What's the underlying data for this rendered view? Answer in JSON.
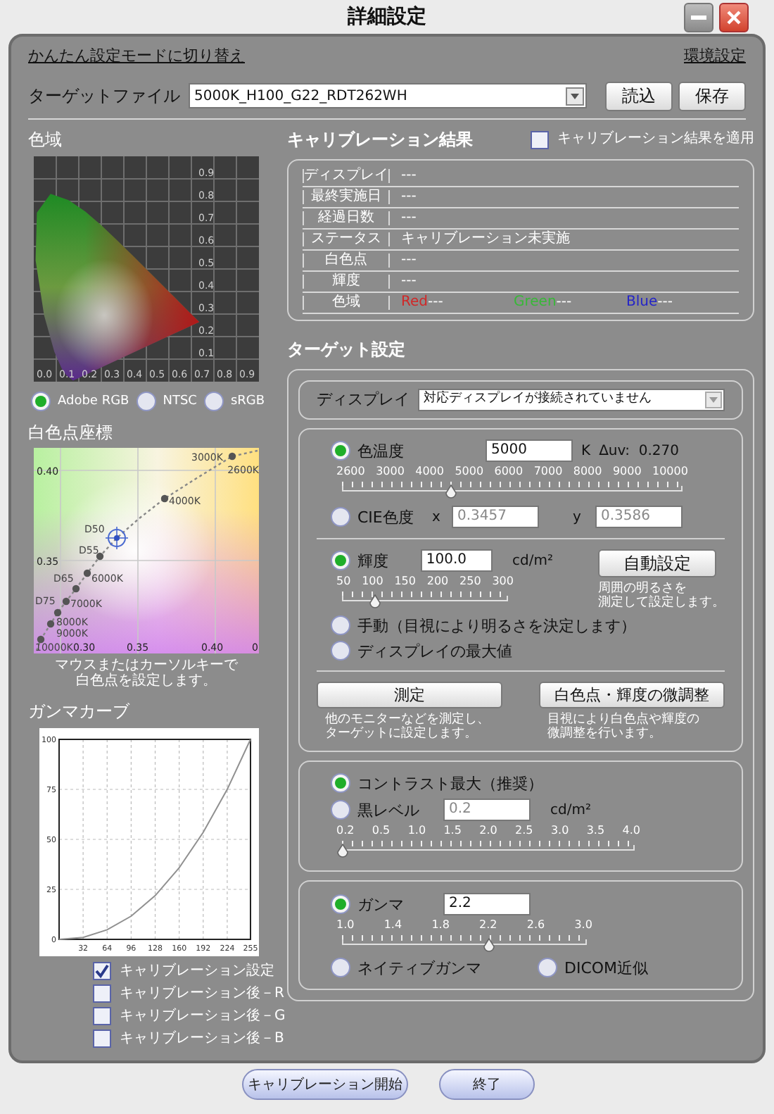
{
  "window": {
    "title": "詳細設定"
  },
  "links": [
    "かんたん設定モードに切り替え",
    "環境設定"
  ],
  "target_file": {
    "label": "ターゲットファイル",
    "value": "5000K_H100_G22_RDT262WH",
    "buttons": [
      "読込",
      "保存"
    ]
  },
  "gamut": {
    "title": "色域",
    "x_ticks": [
      "0.0",
      "0.1",
      "0.2",
      "0.3",
      "0.4",
      "0.5",
      "0.6",
      "0.7",
      "0.8",
      "0.9"
    ],
    "y_ticks": [
      "0.9",
      "0.8",
      "0.7",
      "0.6",
      "0.5",
      "0.4",
      "0.3",
      "0.2",
      "0.1"
    ],
    "options": [
      {
        "label": "Adobe RGB",
        "selected": true
      },
      {
        "label": "NTSC",
        "selected": false
      },
      {
        "label": "sRGB",
        "selected": false
      }
    ]
  },
  "white_point": {
    "title": "白色点座標",
    "y_ticks": [
      "0.40",
      "0.35"
    ],
    "x_ticks": [
      "0.30",
      "0.35",
      "0.40",
      "0"
    ],
    "locus_labels": [
      "3000K",
      "2600K",
      "4000K",
      "D50",
      "D55",
      "D65",
      "6000K",
      "D75",
      "7000K",
      "8000K",
      "9000K",
      "10000K"
    ],
    "caption": [
      "マウスまたはカーソルキーで",
      "白色点を設定します。"
    ]
  },
  "gamma_curve": {
    "title": "ガンマカーブ",
    "chart_data": {
      "type": "line",
      "x": [
        0,
        32,
        64,
        96,
        128,
        160,
        192,
        224,
        255
      ],
      "xticks": [
        32,
        64,
        96,
        128,
        160,
        192,
        224,
        255
      ],
      "yticks": [
        0,
        25,
        50,
        75,
        100
      ],
      "xlim": [
        0,
        255
      ],
      "ylim": [
        0,
        100
      ],
      "grid": true,
      "series": [
        {
          "color": "#909090",
          "values": [
            0,
            1.0,
            4.8,
            11.6,
            21.9,
            35.8,
            53.5,
            75.1,
            100
          ]
        }
      ]
    },
    "checks": [
      {
        "label": "キャリブレーション設定",
        "checked": true
      },
      {
        "label": "キャリブレーション後－R",
        "checked": false
      },
      {
        "label": "キャリブレーション後－G",
        "checked": false
      },
      {
        "label": "キャリブレーション後－B",
        "checked": false
      }
    ]
  },
  "results": {
    "title": "キャリブレーション結果",
    "apply": {
      "label": "キャリブレーション結果を適用",
      "checked": false
    },
    "rows": [
      {
        "kind": "text",
        "label": "ディスプレイ",
        "value": "---"
      },
      {
        "kind": "text",
        "label": "最終実施日",
        "value": "---"
      },
      {
        "kind": "text",
        "label": "経過日数",
        "value": "---"
      },
      {
        "kind": "text",
        "label": "ステータス",
        "value": "キャリブレーション未実施"
      },
      {
        "kind": "text",
        "label": "白色点",
        "value": "---"
      },
      {
        "kind": "text",
        "label": "輝度",
        "value": "---"
      },
      {
        "kind": "gamut",
        "label": "色域",
        "values": [
          {
            "name": "Red",
            "value": "---",
            "color": "#d02828"
          },
          {
            "name": "Green",
            "value": "---",
            "color": "#38b838"
          },
          {
            "name": "Blue",
            "value": "---",
            "color": "#2424c8"
          }
        ]
      }
    ]
  },
  "target": {
    "title": "ターゲット設定",
    "display": {
      "label": "ディスプレイ",
      "value": "対応ディスプレイが接続されていません"
    },
    "white_point": {
      "options": [
        {
          "kind": "temperature",
          "label": "色温度",
          "selected": true,
          "value": "5000",
          "unit": "K",
          "delta": "Δuv:  0.270",
          "scale": [
            "2600",
            "3000",
            "4000",
            "5000",
            "6000",
            "7000",
            "8000",
            "9000",
            "10000"
          ],
          "level": 0.32
        },
        {
          "kind": "cie",
          "label": "CIE色度",
          "selected": false,
          "x_label": "x",
          "x_value": "0.3457",
          "y_label": "y",
          "y_value": "0.3586"
        }
      ]
    },
    "luminance": {
      "aside": {
        "button": "自動設定",
        "note": [
          "周囲の明るさを",
          "測定して設定します。"
        ]
      },
      "options": [
        {
          "kind": "value",
          "label": "輝度",
          "selected": true,
          "value": "100.0",
          "unit": "cd/m²",
          "scale": [
            "50",
            "100",
            "150",
            "200",
            "250",
            "300"
          ],
          "level": 0.2
        },
        {
          "kind": "plain",
          "label": "手動（目視により明るさを決定します）",
          "selected": false
        },
        {
          "kind": "plain",
          "label": "ディスプレイの最大値",
          "selected": false
        }
      ]
    },
    "actions": [
      {
        "button": "測定",
        "note": [
          "他のモニターなどを測定し、",
          "ターゲットに設定します。"
        ]
      },
      {
        "button": "白色点・輝度の微調整",
        "note": [
          "目視により白色点や輝度の",
          "微調整を行います。"
        ]
      }
    ],
    "contrast": {
      "options": [
        {
          "kind": "plain",
          "label": "コントラスト最大（推奨）",
          "selected": true
        },
        {
          "kind": "value",
          "label": "黒レベル",
          "selected": false,
          "value": "0.2",
          "unit": "cd/m²",
          "scale": [
            "0.2",
            "0.5",
            "1.0",
            "1.5",
            "2.0",
            "2.5",
            "3.0",
            "3.5",
            "4.0"
          ],
          "level": 0
        }
      ]
    },
    "gamma": {
      "options": [
        {
          "kind": "value",
          "label": "ガンマ",
          "selected": true,
          "value": "2.2",
          "scale": [
            "1.0",
            "1.4",
            "1.8",
            "2.2",
            "2.6",
            "3.0"
          ],
          "level": 0.6
        },
        {
          "kind": "plain",
          "label": "ネイティブガンマ",
          "selected": false
        },
        {
          "kind": "plain",
          "label": "DICOM近似",
          "selected": false
        }
      ]
    }
  },
  "footer": {
    "buttons": [
      "キャリブレーション開始",
      "終了"
    ]
  }
}
